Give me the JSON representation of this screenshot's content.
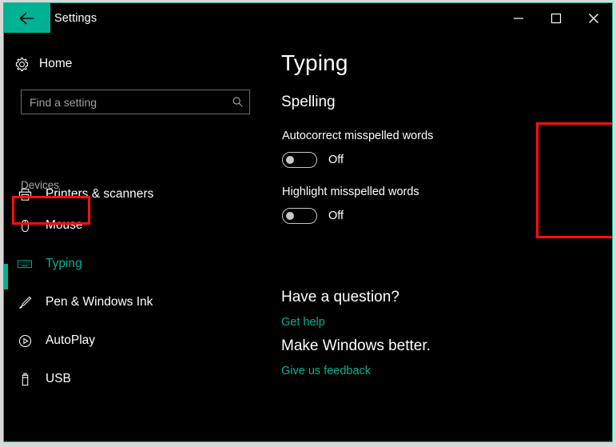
{
  "window": {
    "title": "Settings",
    "accent_color": "#00b294",
    "background_color": "#000000",
    "annotation_color": "#ff0f0f"
  },
  "titlebar": {
    "back_icon": "back-arrow-icon",
    "minimize_label": "Minimize",
    "maximize_label": "Maximize",
    "close_label": "Close"
  },
  "sidebar": {
    "home": {
      "label": "Home",
      "icon": "gear-icon"
    },
    "search": {
      "placeholder": "Find a setting",
      "value": "",
      "icon": "search-icon"
    },
    "group_header": "Devices",
    "items": [
      {
        "label": "Printers & scanners",
        "icon": "printer-icon",
        "selected": false
      },
      {
        "label": "Mouse",
        "icon": "mouse-icon",
        "selected": false
      },
      {
        "label": "Typing",
        "icon": "keyboard-icon",
        "selected": true
      },
      {
        "label": "Pen & Windows Ink",
        "icon": "pen-icon",
        "selected": false
      },
      {
        "label": "AutoPlay",
        "icon": "autoplay-icon",
        "selected": false
      },
      {
        "label": "USB",
        "icon": "usb-icon",
        "selected": false
      }
    ]
  },
  "main": {
    "page_title": "Typing",
    "spelling": {
      "header": "Spelling",
      "autocorrect": {
        "label": "Autocorrect misspelled words",
        "state": "Off"
      },
      "highlight": {
        "label": "Highlight misspelled words",
        "state": "Off"
      }
    },
    "question": {
      "heading": "Have a question?",
      "link": "Get help"
    },
    "feedback": {
      "heading": "Make Windows better.",
      "link": "Give us feedback"
    }
  }
}
